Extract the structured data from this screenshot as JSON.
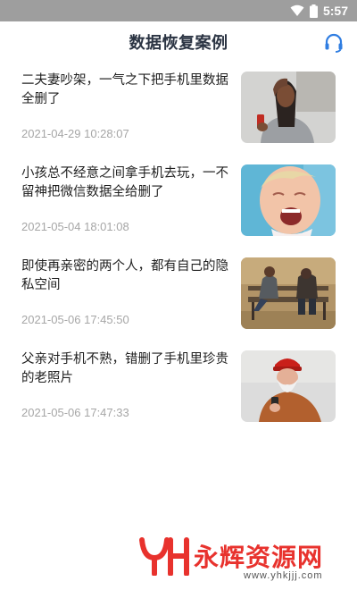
{
  "status_bar": {
    "time": "5:57",
    "icons": [
      "wifi-icon",
      "battery-icon"
    ]
  },
  "header": {
    "title": "数据恢复案例",
    "support_icon": "headset-icon"
  },
  "cases": [
    {
      "text": "二夫妻吵架，一气之下把手机里数据全删了",
      "date": "2021-04-29 10:28:07",
      "image": "woman-with-phone-photo"
    },
    {
      "text": "小孩总不经意之间拿手机去玩，一不留神把微信数据全给删了",
      "date": "2021-05-04 18:01:08",
      "image": "crying-child-photo"
    },
    {
      "text": "即使再亲密的两个人，都有自己的隐私空间",
      "date": "2021-05-06 17:45:50",
      "image": "couple-on-bench-photo"
    },
    {
      "text": "父亲对手机不熟，错删了手机里珍贵的老照片",
      "date": "2021-05-06 17:47:33",
      "image": "old-man-with-phone-photo"
    }
  ],
  "watermark": {
    "name": "永辉资源网",
    "url": "www.yhkjjj.com"
  },
  "colors": {
    "status_bar": "#9e9e9e",
    "title": "#2b3443",
    "accent": "#2f7de1",
    "date": "#a6a6a6",
    "watermark": "#e8322d"
  }
}
